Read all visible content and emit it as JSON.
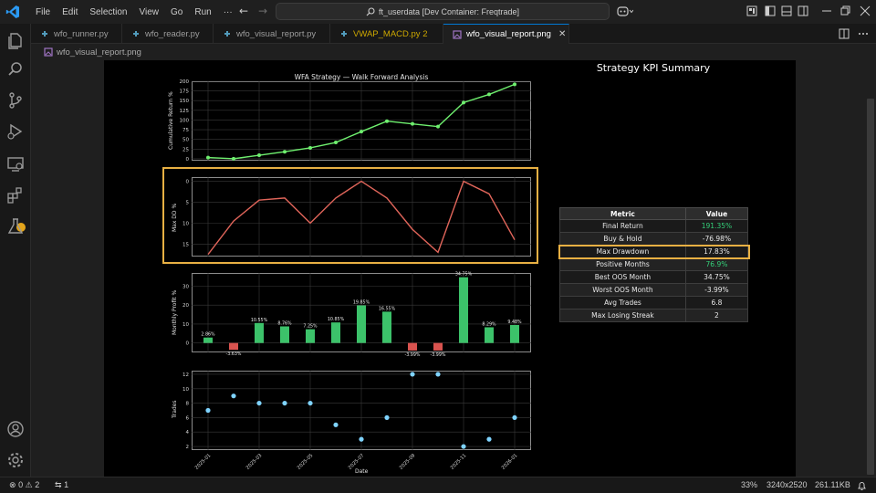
{
  "titlebar": {
    "menus": [
      "File",
      "Edit",
      "Selection",
      "View",
      "Go",
      "Run",
      "···"
    ],
    "search_text": "ft_userdata [Dev Container: Freqtrade]"
  },
  "tabs": [
    {
      "label": "wfo_runner.py",
      "icon": "python-icon",
      "active": false,
      "warn": false
    },
    {
      "label": "wfo_reader.py",
      "icon": "python-icon",
      "active": false,
      "warn": false
    },
    {
      "label": "wfo_visual_report.py",
      "icon": "python-icon",
      "active": false,
      "warn": false
    },
    {
      "label": "VWAP_MACD.py 2",
      "icon": "python-icon",
      "active": false,
      "warn": true
    },
    {
      "label": "wfo_visual_report.png",
      "icon": "image-icon",
      "active": true,
      "warn": false
    }
  ],
  "breadcrumb": {
    "label": "wfo_visual_report.png"
  },
  "statusbar": {
    "errors": "0",
    "warnings": "2",
    "ports": "1",
    "zoom": "33%",
    "dimensions": "3240x2520",
    "filesize": "261.11KB"
  },
  "colors": {
    "line_green": "#6ff06f",
    "line_red": "#e0655a",
    "bar_green": "#3cc26a",
    "bar_red": "#d9534f",
    "scatter_blue": "#7fd3ff",
    "highlight": "#e8b043",
    "accent": "#0078d4"
  },
  "kpi": {
    "title": "Strategy KPI Summary",
    "headers": [
      "Metric",
      "Value"
    ],
    "rows": [
      {
        "metric": "Final Return",
        "value": "191.35%",
        "green": true
      },
      {
        "metric": "Buy & Hold",
        "value": "-76.98%",
        "green": false
      },
      {
        "metric": "Max Drawdown",
        "value": "17.83%",
        "green": false
      },
      {
        "metric": "Positive Months",
        "value": "76.9%",
        "green": true
      },
      {
        "metric": "Best OOS Month",
        "value": "34.75%",
        "green": false
      },
      {
        "metric": "Worst OOS Month",
        "value": "-3.99%",
        "green": false
      },
      {
        "metric": "Avg Trades",
        "value": "6.8",
        "green": false
      },
      {
        "metric": "Max Losing Streak",
        "value": "2",
        "green": false
      }
    ]
  },
  "chart_data": [
    {
      "type": "line",
      "title": "WFA Strategy — Walk Forward Analysis",
      "ylabel": "Cumulative Return %",
      "ylim": [
        -5,
        200
      ],
      "yticks": [
        "0",
        "25",
        "50",
        "75",
        "100",
        "125",
        "150",
        "175",
        "200"
      ],
      "grid": true,
      "series": [
        {
          "values": [
            3,
            0,
            9,
            18,
            28,
            42,
            70,
            97,
            90,
            83,
            145,
            166,
            192
          ]
        }
      ]
    },
    {
      "type": "line",
      "ylabel": "Max DD %",
      "ylim": [
        18,
        -1
      ],
      "yticks": [
        "0",
        "5",
        "10",
        "15"
      ],
      "grid": true,
      "series": [
        {
          "values": [
            17.5,
            9.5,
            4.5,
            4,
            10,
            4,
            0,
            4,
            11.5,
            17,
            0,
            3,
            14
          ]
        }
      ]
    },
    {
      "type": "bar",
      "ylabel": "Monthly Profit %",
      "ylim": [
        -5,
        37
      ],
      "yticks": [
        "0",
        "10",
        "20",
        "30"
      ],
      "grid": true,
      "values": [
        2.86,
        -3.63,
        10.55,
        8.76,
        7.25,
        10.85,
        19.85,
        16.55,
        -3.99,
        -3.99,
        34.75,
        8.29,
        9.48
      ],
      "data_labels": [
        "2.86%",
        "-3.63%",
        "10.55%",
        "8.76%",
        "7.25%",
        "10.85%",
        "19.85%",
        "16.55%",
        "-3.99%",
        "-3.99%",
        "34.75%",
        "8.29%",
        "9.48%"
      ]
    },
    {
      "type": "scatter",
      "ylabel": "Trades",
      "xlabel": "Date",
      "ylim": [
        1.5,
        12.5
      ],
      "yticks": [
        "2",
        "4",
        "6",
        "8",
        "10",
        "12"
      ],
      "xticks": [
        "2025-01",
        "2025-03",
        "2025-05",
        "2025-07",
        "2025-09",
        "2025-11",
        "2026-01"
      ],
      "grid": true,
      "values": [
        7,
        9,
        8,
        8,
        8,
        5,
        3,
        6,
        12,
        12,
        2,
        3,
        6
      ]
    }
  ]
}
